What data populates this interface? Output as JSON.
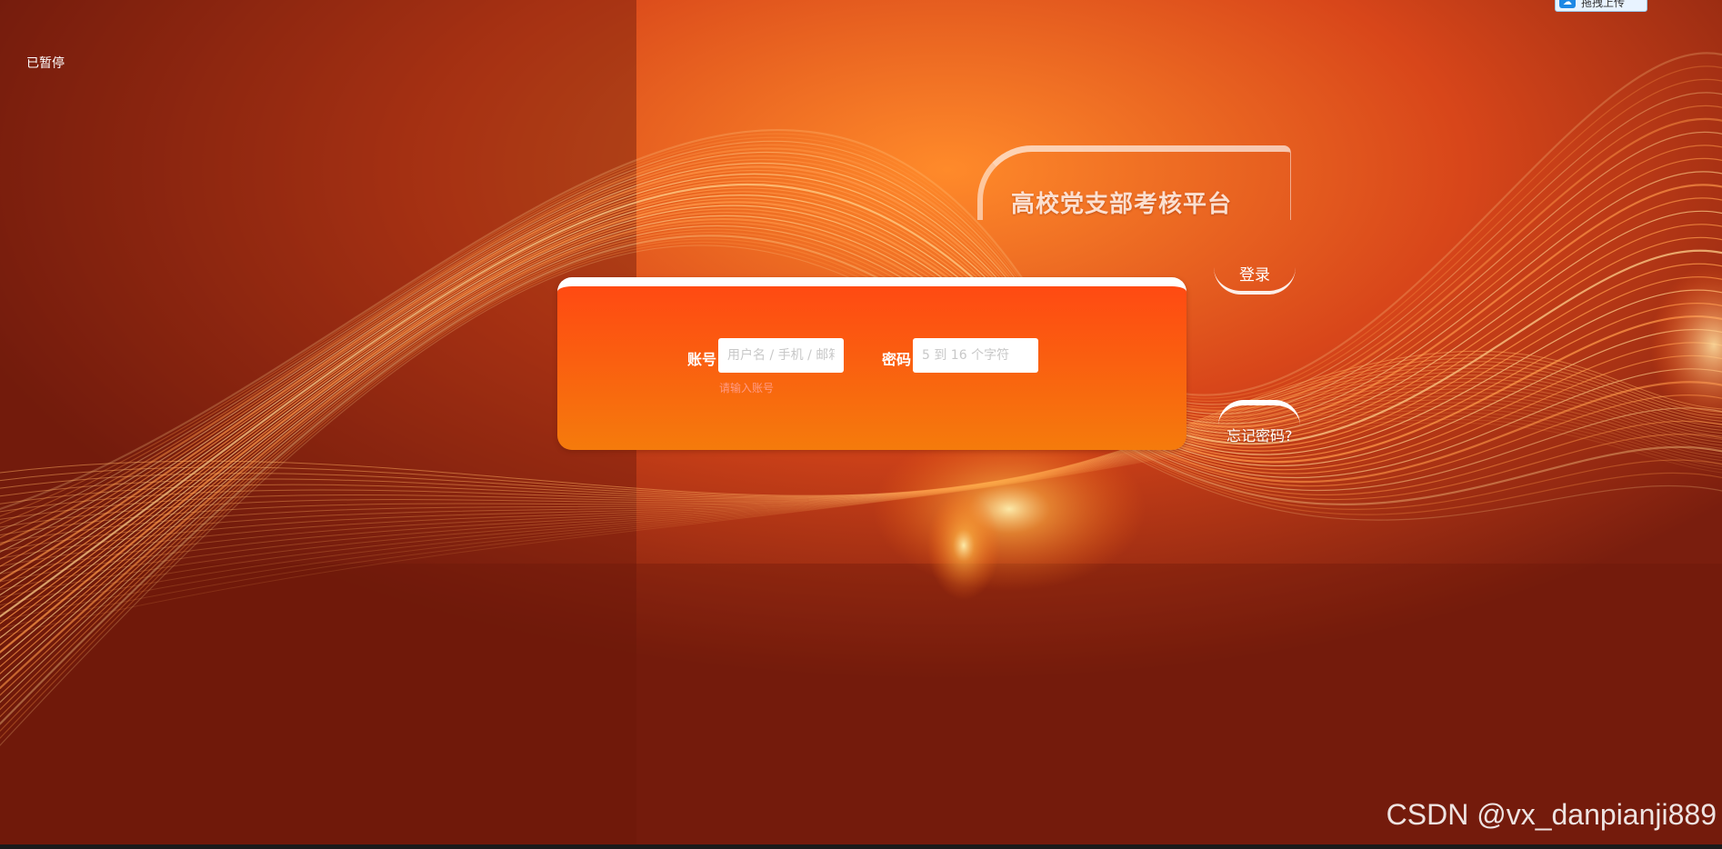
{
  "status": {
    "paused_label": "已暂停"
  },
  "upload_badge": {
    "label": "拖拽上传",
    "icon": "cloud-icon"
  },
  "header": {
    "title": "高校党支部考核平台"
  },
  "login": {
    "button_label": "登录"
  },
  "form": {
    "account_label": "账号",
    "account_placeholder": "用户名 / 手机 / 邮箱",
    "account_error": "请输入账号",
    "password_label": "密码",
    "password_placeholder": "5 到 16 个字符"
  },
  "forgot_password": {
    "label": "忘记密码?"
  },
  "watermark": "CSDN @vx_danpianji889",
  "colors": {
    "accent": "#ff4a12",
    "panel_bottom": "#f57b0c",
    "background": "#8a2410"
  }
}
